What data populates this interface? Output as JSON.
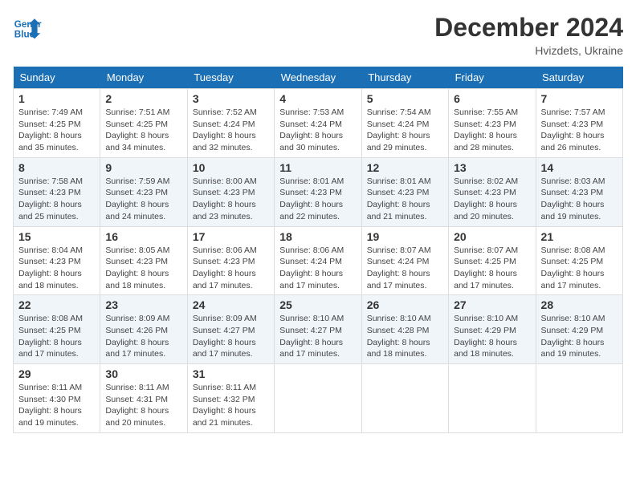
{
  "header": {
    "logo_line1": "General",
    "logo_line2": "Blue",
    "month_title": "December 2024",
    "location": "Hvizdets, Ukraine"
  },
  "days_of_week": [
    "Sunday",
    "Monday",
    "Tuesday",
    "Wednesday",
    "Thursday",
    "Friday",
    "Saturday"
  ],
  "weeks": [
    [
      {
        "day": "1",
        "sunrise": "7:49 AM",
        "sunset": "4:25 PM",
        "daylight": "8 hours and 35 minutes."
      },
      {
        "day": "2",
        "sunrise": "7:51 AM",
        "sunset": "4:25 PM",
        "daylight": "8 hours and 34 minutes."
      },
      {
        "day": "3",
        "sunrise": "7:52 AM",
        "sunset": "4:24 PM",
        "daylight": "8 hours and 32 minutes."
      },
      {
        "day": "4",
        "sunrise": "7:53 AM",
        "sunset": "4:24 PM",
        "daylight": "8 hours and 30 minutes."
      },
      {
        "day": "5",
        "sunrise": "7:54 AM",
        "sunset": "4:24 PM",
        "daylight": "8 hours and 29 minutes."
      },
      {
        "day": "6",
        "sunrise": "7:55 AM",
        "sunset": "4:23 PM",
        "daylight": "8 hours and 28 minutes."
      },
      {
        "day": "7",
        "sunrise": "7:57 AM",
        "sunset": "4:23 PM",
        "daylight": "8 hours and 26 minutes."
      }
    ],
    [
      {
        "day": "8",
        "sunrise": "7:58 AM",
        "sunset": "4:23 PM",
        "daylight": "8 hours and 25 minutes."
      },
      {
        "day": "9",
        "sunrise": "7:59 AM",
        "sunset": "4:23 PM",
        "daylight": "8 hours and 24 minutes."
      },
      {
        "day": "10",
        "sunrise": "8:00 AM",
        "sunset": "4:23 PM",
        "daylight": "8 hours and 23 minutes."
      },
      {
        "day": "11",
        "sunrise": "8:01 AM",
        "sunset": "4:23 PM",
        "daylight": "8 hours and 22 minutes."
      },
      {
        "day": "12",
        "sunrise": "8:01 AM",
        "sunset": "4:23 PM",
        "daylight": "8 hours and 21 minutes."
      },
      {
        "day": "13",
        "sunrise": "8:02 AM",
        "sunset": "4:23 PM",
        "daylight": "8 hours and 20 minutes."
      },
      {
        "day": "14",
        "sunrise": "8:03 AM",
        "sunset": "4:23 PM",
        "daylight": "8 hours and 19 minutes."
      }
    ],
    [
      {
        "day": "15",
        "sunrise": "8:04 AM",
        "sunset": "4:23 PM",
        "daylight": "8 hours and 18 minutes."
      },
      {
        "day": "16",
        "sunrise": "8:05 AM",
        "sunset": "4:23 PM",
        "daylight": "8 hours and 18 minutes."
      },
      {
        "day": "17",
        "sunrise": "8:06 AM",
        "sunset": "4:23 PM",
        "daylight": "8 hours and 17 minutes."
      },
      {
        "day": "18",
        "sunrise": "8:06 AM",
        "sunset": "4:24 PM",
        "daylight": "8 hours and 17 minutes."
      },
      {
        "day": "19",
        "sunrise": "8:07 AM",
        "sunset": "4:24 PM",
        "daylight": "8 hours and 17 minutes."
      },
      {
        "day": "20",
        "sunrise": "8:07 AM",
        "sunset": "4:25 PM",
        "daylight": "8 hours and 17 minutes."
      },
      {
        "day": "21",
        "sunrise": "8:08 AM",
        "sunset": "4:25 PM",
        "daylight": "8 hours and 17 minutes."
      }
    ],
    [
      {
        "day": "22",
        "sunrise": "8:08 AM",
        "sunset": "4:25 PM",
        "daylight": "8 hours and 17 minutes."
      },
      {
        "day": "23",
        "sunrise": "8:09 AM",
        "sunset": "4:26 PM",
        "daylight": "8 hours and 17 minutes."
      },
      {
        "day": "24",
        "sunrise": "8:09 AM",
        "sunset": "4:27 PM",
        "daylight": "8 hours and 17 minutes."
      },
      {
        "day": "25",
        "sunrise": "8:10 AM",
        "sunset": "4:27 PM",
        "daylight": "8 hours and 17 minutes."
      },
      {
        "day": "26",
        "sunrise": "8:10 AM",
        "sunset": "4:28 PM",
        "daylight": "8 hours and 18 minutes."
      },
      {
        "day": "27",
        "sunrise": "8:10 AM",
        "sunset": "4:29 PM",
        "daylight": "8 hours and 18 minutes."
      },
      {
        "day": "28",
        "sunrise": "8:10 AM",
        "sunset": "4:29 PM",
        "daylight": "8 hours and 19 minutes."
      }
    ],
    [
      {
        "day": "29",
        "sunrise": "8:11 AM",
        "sunset": "4:30 PM",
        "daylight": "8 hours and 19 minutes."
      },
      {
        "day": "30",
        "sunrise": "8:11 AM",
        "sunset": "4:31 PM",
        "daylight": "8 hours and 20 minutes."
      },
      {
        "day": "31",
        "sunrise": "8:11 AM",
        "sunset": "4:32 PM",
        "daylight": "8 hours and 21 minutes."
      },
      null,
      null,
      null,
      null
    ]
  ],
  "labels": {
    "sunrise": "Sunrise:",
    "sunset": "Sunset:",
    "daylight": "Daylight:"
  }
}
